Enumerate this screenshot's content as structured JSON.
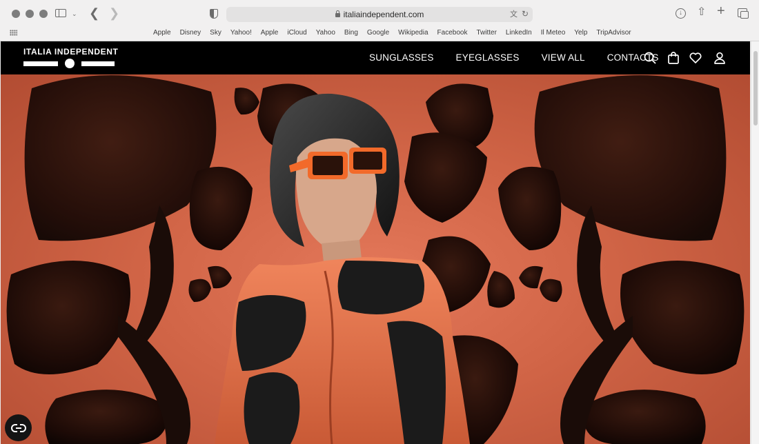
{
  "browser": {
    "url": "italiaindependent.com",
    "favorites": [
      "Apple",
      "Disney",
      "Sky",
      "Yahoo!",
      "Apple",
      "iCloud",
      "Yahoo",
      "Bing",
      "Google",
      "Wikipedia",
      "Facebook",
      "Twitter",
      "LinkedIn",
      "Il Meteo",
      "Yelp",
      "TripAdvisor"
    ]
  },
  "site": {
    "logo": "ITALIA INDEPENDENT",
    "nav": [
      "SUNGLASSES",
      "EYEGLASSES",
      "VIEW ALL",
      "CONTACTS"
    ]
  },
  "colors": {
    "nav_bg": "#000000",
    "hero_accent": "#d4684a",
    "shape_dark": "#1a0c08",
    "glasses_orange": "#f26a2a"
  },
  "icons": {
    "nav": [
      "search-icon",
      "bag-icon",
      "heart-icon",
      "user-icon"
    ],
    "accessibility": "accessibility-icon"
  }
}
